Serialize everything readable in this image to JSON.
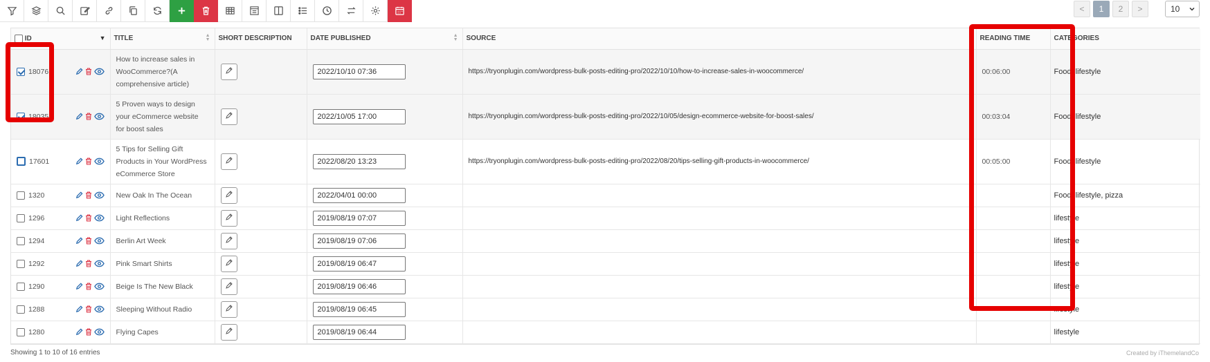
{
  "toolbar": {
    "icons": [
      "filter-icon",
      "layers-icon",
      "search-icon",
      "edit-icon",
      "link-icon",
      "copy-icon",
      "refresh-icon",
      "add-icon",
      "trash-icon",
      "table-icon",
      "grid-icon",
      "columns-icon",
      "list-icon",
      "clock-icon",
      "swap-icon",
      "gear-icon",
      "calendar-icon"
    ]
  },
  "pagination": {
    "prev": "<",
    "pages": [
      "1",
      "2"
    ],
    "active_page": "1",
    "next": ">",
    "per_page": "10"
  },
  "table": {
    "columns": [
      "ID",
      "TITLE",
      "SHORT DESCRIPTION",
      "DATE PUBLISHED",
      "SOURCE",
      "READING TIME",
      "CATEGORIES"
    ],
    "rows": [
      {
        "id": "18076",
        "checked": true,
        "title": "How to increase sales in WooCommerce?(A comprehensive article)",
        "date": "2022/10/10 07:36",
        "source": "https://tryonplugin.com/wordpress-bulk-posts-editing-pro/2022/10/10/how-to-increase-sales-in-woocommerce/",
        "reading_time": "00:06:00",
        "categories": "Food, lifestyle"
      },
      {
        "id": "18035",
        "checked": true,
        "title": "5 Proven ways to design your eCommerce website for boost sales",
        "date": "2022/10/05 17:00",
        "source": "https://tryonplugin.com/wordpress-bulk-posts-editing-pro/2022/10/05/design-ecommerce-website-for-boost-sales/",
        "reading_time": "00:03:04",
        "categories": "Food, lifestyle"
      },
      {
        "id": "17601",
        "checked": false,
        "title": "5 Tips for Selling Gift Products in Your WordPress eCommerce Store",
        "date": "2022/08/20 13:23",
        "source": "https://tryonplugin.com/wordpress-bulk-posts-editing-pro/2022/08/20/tips-selling-gift-products-in-woocommerce/",
        "reading_time": "00:05:00",
        "categories": "Food, lifestyle"
      },
      {
        "id": "1320",
        "checked": false,
        "title": "New Oak In The Ocean",
        "date": "2022/04/01 00:00",
        "source": "",
        "reading_time": "",
        "categories": "Food, lifestyle, pizza"
      },
      {
        "id": "1296",
        "checked": false,
        "title": "Light Reflections",
        "date": "2019/08/19 07:07",
        "source": "",
        "reading_time": "",
        "categories": "lifestyle"
      },
      {
        "id": "1294",
        "checked": false,
        "title": "Berlin Art Week",
        "date": "2019/08/19 07:06",
        "source": "",
        "reading_time": "",
        "categories": "lifestyle"
      },
      {
        "id": "1292",
        "checked": false,
        "title": "Pink Smart Shirts",
        "date": "2019/08/19 06:47",
        "source": "",
        "reading_time": "",
        "categories": "lifestyle"
      },
      {
        "id": "1290",
        "checked": false,
        "title": "Beige Is The New Black",
        "date": "2019/08/19 06:46",
        "source": "",
        "reading_time": "",
        "categories": "lifestyle"
      },
      {
        "id": "1288",
        "checked": false,
        "title": "Sleeping Without Radio",
        "date": "2019/08/19 06:45",
        "source": "",
        "reading_time": "",
        "categories": "lifestyle"
      },
      {
        "id": "1280",
        "checked": false,
        "title": "Flying Capes",
        "date": "2019/08/19 06:44",
        "source": "",
        "reading_time": "",
        "categories": "lifestyle"
      }
    ]
  },
  "footer": {
    "entries": "Showing 1 to 10 of 16 entries",
    "credit": "Created by iThemelandCo"
  },
  "colors": {
    "highlight": "#e60000",
    "add_button": "#2ea043",
    "delete_button": "#dc3545",
    "action_blue": "#2b6cb0",
    "action_red": "#dc3545"
  }
}
